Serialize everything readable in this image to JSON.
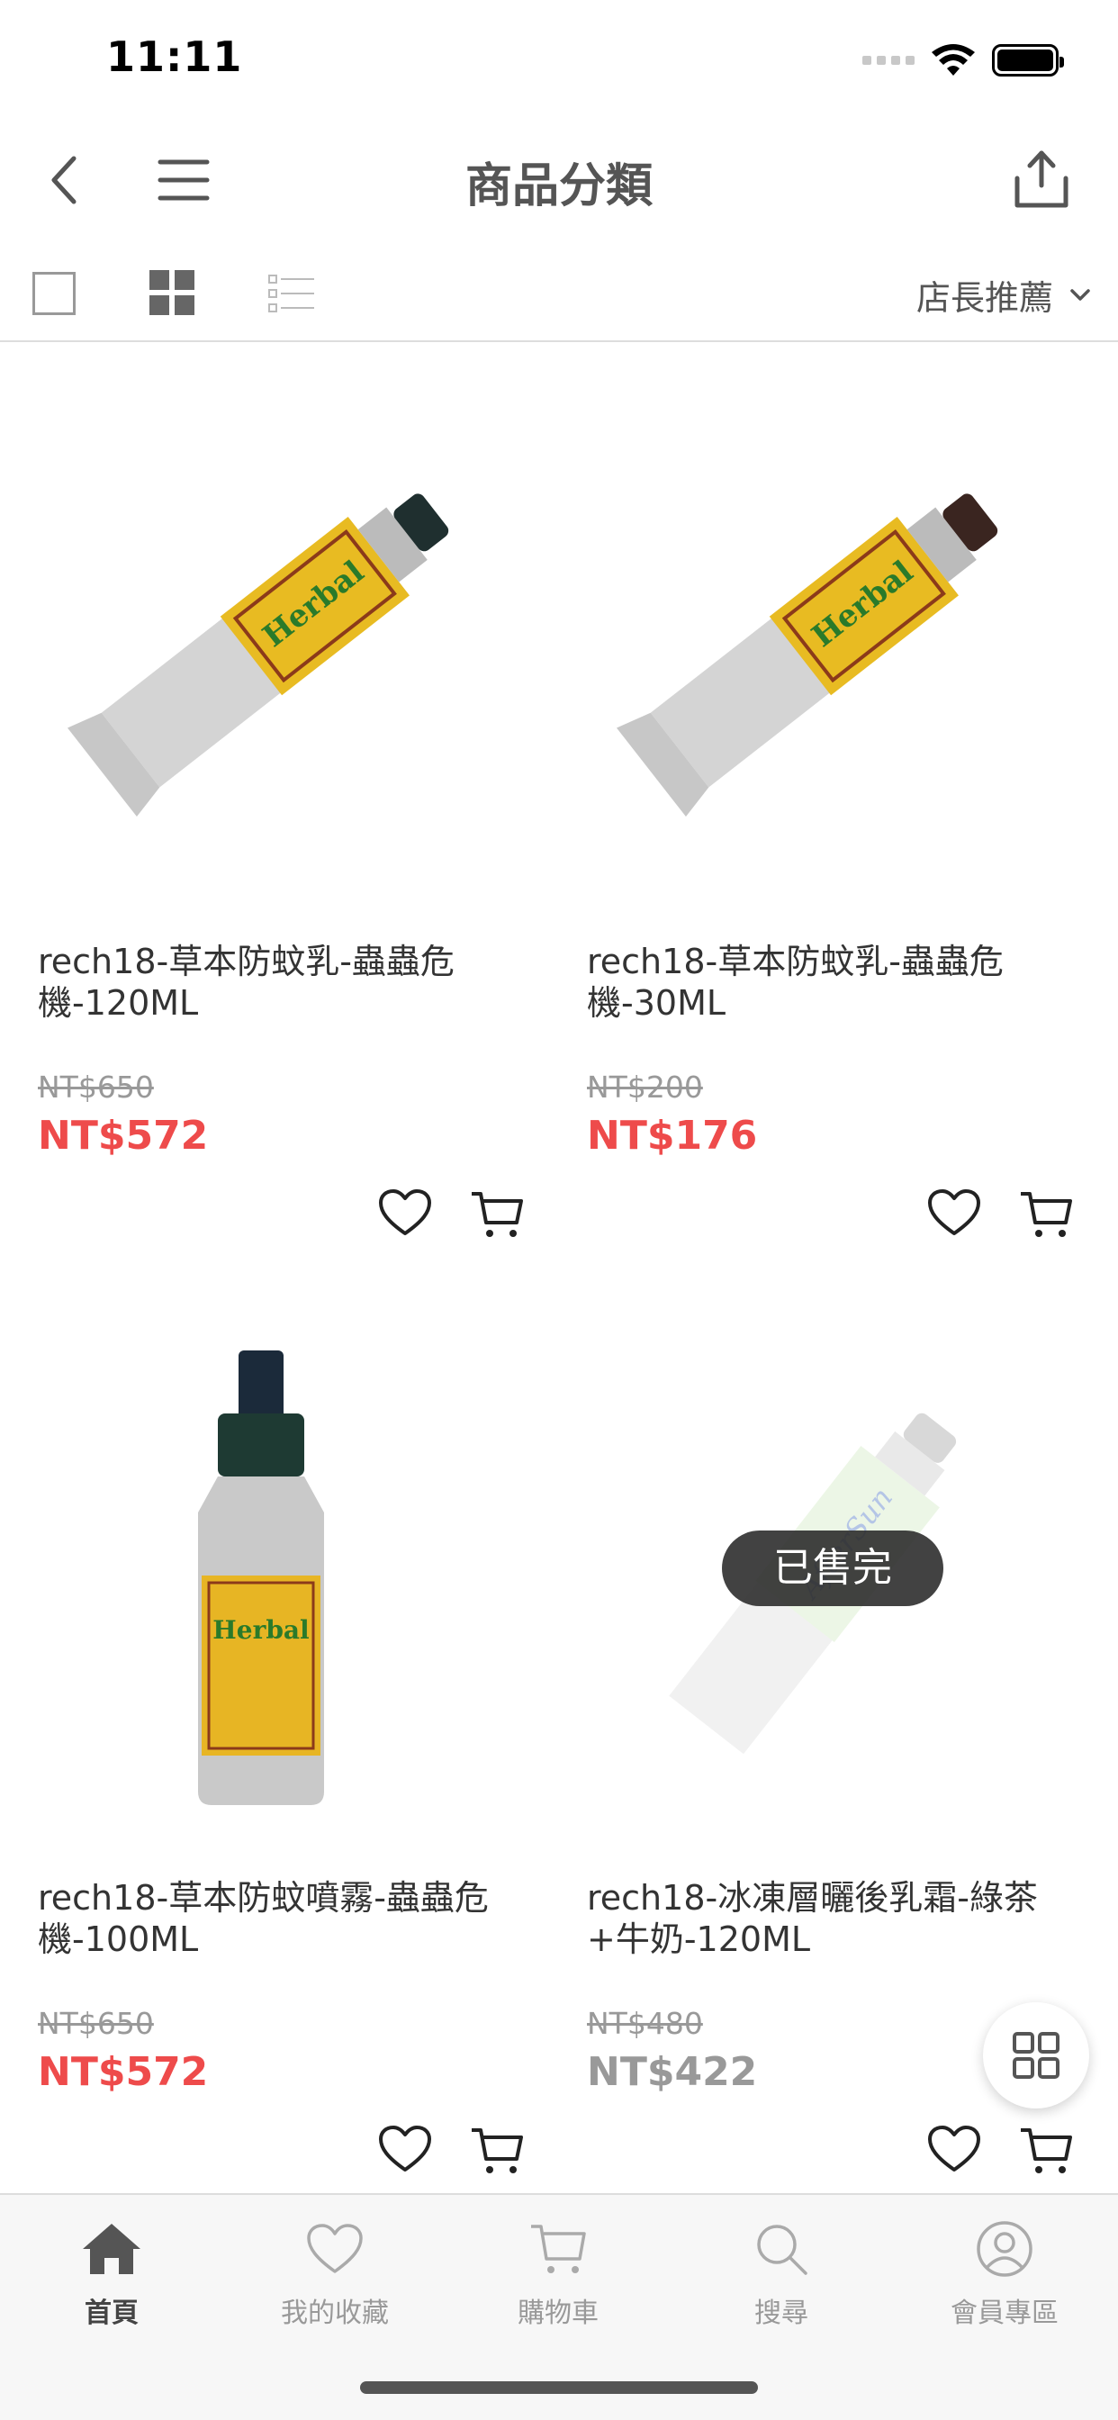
{
  "status_bar": {
    "time": "11:11"
  },
  "nav": {
    "title": "商品分類"
  },
  "filter": {
    "sort_label": "店長推薦"
  },
  "products": [
    {
      "name": "rech18-草本防蚊乳-蟲蟲危機-120ML",
      "original_price": "NT$650",
      "price": "NT$572",
      "sold_out": false
    },
    {
      "name": "rech18-草本防蚊乳-蟲蟲危機-30ML",
      "original_price": "NT$200",
      "price": "NT$176",
      "sold_out": false
    },
    {
      "name": "rech18-草本防蚊噴霧-蟲蟲危機-100ML",
      "original_price": "NT$650",
      "price": "NT$572",
      "sold_out": false
    },
    {
      "name": "rech18-冰凍層曬後乳霜-綠茶+牛奶-120ML",
      "original_price": "NT$480",
      "price": "NT$422",
      "sold_out": true,
      "sold_out_label": "已售完"
    }
  ],
  "tabs": [
    {
      "label": "首頁",
      "icon": "home-icon",
      "active": true
    },
    {
      "label": "我的收藏",
      "icon": "heart-icon",
      "active": false
    },
    {
      "label": "購物車",
      "icon": "cart-icon",
      "active": false
    },
    {
      "label": "搜尋",
      "icon": "search-icon",
      "active": false
    },
    {
      "label": "會員專區",
      "icon": "user-icon",
      "active": false
    }
  ],
  "colors": {
    "sale_price": "#ee4b4b",
    "muted": "#999999",
    "tab_bar_bg": "#f7f7f7"
  }
}
